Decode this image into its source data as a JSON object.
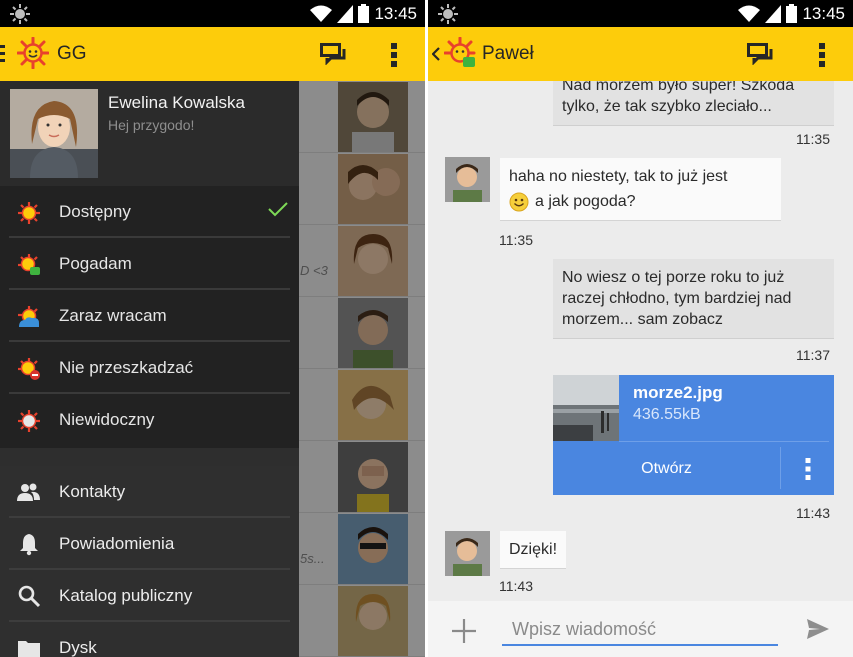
{
  "left": {
    "status_bar": {
      "time": "13:45"
    },
    "app_bar": {
      "title": "GG"
    },
    "profile": {
      "name": "Ewelina Kowalska",
      "status_message": "Hej przygodo!"
    },
    "statuses": [
      {
        "label": "Dostępny",
        "color": "#e8412c",
        "selected": true
      },
      {
        "label": "Pogadam",
        "color": "#3fb33f",
        "selected": false
      },
      {
        "label": "Zaraz wracam",
        "color": "#3a8fd8",
        "selected": false
      },
      {
        "label": "Nie przeszkadzać",
        "color": "#d8342d",
        "selected": false
      },
      {
        "label": "Niewidoczny",
        "color": "#9a9a9a",
        "selected": false
      }
    ],
    "menu": [
      {
        "label": "Kontakty",
        "icon": "contacts-icon"
      },
      {
        "label": "Powiadomienia",
        "icon": "bell-icon"
      },
      {
        "label": "Katalog publiczny",
        "icon": "search-icon"
      },
      {
        "label": "Dysk",
        "icon": "folder-icon"
      }
    ],
    "background_snippets": [
      "D <3",
      "5s..."
    ]
  },
  "right": {
    "status_bar": {
      "time": "13:45"
    },
    "app_bar": {
      "title": "Paweł"
    },
    "messages": [
      {
        "direction": "out",
        "text": "Nad morzem było super! Szkoda tylko, że tak szybko zleciało...",
        "time": "11:35"
      },
      {
        "direction": "in",
        "text": "haha no niestety, tak to już jest",
        "text2": "a jak pogoda?",
        "time": "11:35"
      },
      {
        "direction": "out",
        "text": "No wiesz o tej porze roku to już raczej chłodno, tym bardziej nad morzem... sam zobacz",
        "time": "11:37"
      },
      {
        "direction": "out",
        "type": "file",
        "file_name": "morze2.jpg",
        "file_size": "436.55kB",
        "action": "Otwórz",
        "time": "11:43"
      },
      {
        "direction": "in",
        "text": "Dzięki!",
        "time": "11:43"
      }
    ],
    "input": {
      "placeholder": "Wpisz wiadomość",
      "value": ""
    }
  },
  "colors": {
    "brand_yellow": "#fdcc0b",
    "accent_blue": "#4a86e0",
    "check_green": "#7ed957"
  }
}
